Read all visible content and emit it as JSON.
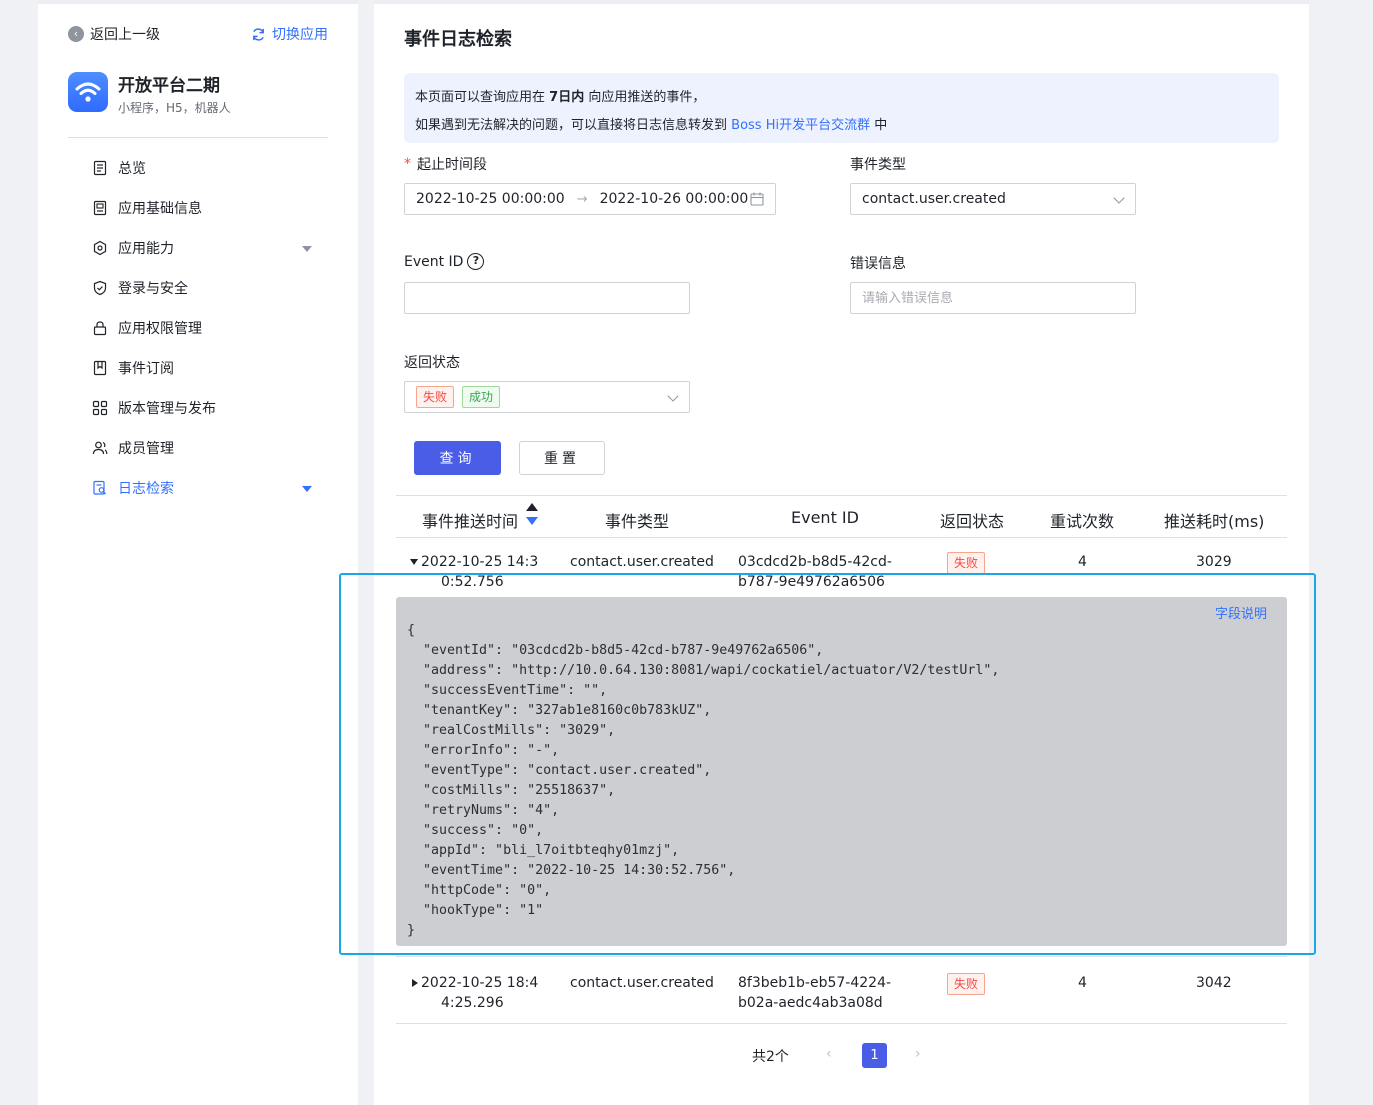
{
  "sidebar": {
    "back_label": "返回上一级",
    "switch_label": "切换应用",
    "app_name": "开放平台二期",
    "app_desc": "小程序，H5，机器人",
    "items": [
      {
        "label": "总览"
      },
      {
        "label": "应用基础信息"
      },
      {
        "label": "应用能力"
      },
      {
        "label": "登录与安全"
      },
      {
        "label": "应用权限管理"
      },
      {
        "label": "事件订阅"
      },
      {
        "label": "版本管理与发布"
      },
      {
        "label": "成员管理"
      },
      {
        "label": "日志检索"
      }
    ]
  },
  "main": {
    "title": "事件日志检索",
    "notice": {
      "line1_a": "本页面可以查询应用在",
      "line1_em": "7日内",
      "line1_b": "向应用推送的事件，",
      "line2_a": "如果遇到无法解决的问题，可以直接将日志信息转发到",
      "line2_link": "Boss Hi开发平台交流群",
      "line2_b": "中"
    },
    "form": {
      "time_label": "起止时间段",
      "time_start": "2022-10-25 00:00:00",
      "time_end": "2022-10-26 00:00:00",
      "event_type_label": "事件类型",
      "event_type_value": "contact.user.created",
      "event_id_label": "Event ID",
      "event_id_value": "",
      "error_label": "错误信息",
      "error_placeholder": "请输入错误信息",
      "status_label": "返回状态",
      "status_tags": [
        "失败",
        "成功"
      ],
      "query_btn": "查询",
      "reset_btn": "重置"
    },
    "table": {
      "columns": [
        "事件推送时间",
        "事件类型",
        "Event ID",
        "返回状态",
        "重试次数",
        "推送耗时(ms)"
      ],
      "rows": [
        {
          "time_l1": "2022-10-25 14:3",
          "time_l2": "0:52.756",
          "type": "contact.user.created",
          "id_l1": "03cdcd2b-b8d5-42cd-",
          "id_l2": "b787-9e49762a6506",
          "status": "失败",
          "retries": "4",
          "cost": "3029",
          "expanded": true
        },
        {
          "time_l1": "2022-10-25 18:4",
          "time_l2": "4:25.296",
          "type": "contact.user.created",
          "id_l1": "8f3beb1b-eb57-4224-",
          "id_l2": "b02a-aedc4ab3a08d",
          "status": "失败",
          "retries": "4",
          "cost": "3042",
          "expanded": false
        }
      ],
      "detail_link": "字段说明",
      "detail_json": "{\n  \"eventId\": \"03cdcd2b-b8d5-42cd-b787-9e49762a6506\",\n  \"address\": \"http://10.0.64.130:8081/wapi/cockatiel/actuator/V2/testUrl\",\n  \"successEventTime\": \"\",\n  \"tenantKey\": \"327ab1e8160c0b783kUZ\",\n  \"realCostMills\": \"3029\",\n  \"errorInfo\": \"-\",\n  \"eventType\": \"contact.user.created\",\n  \"costMills\": \"25518637\",\n  \"retryNums\": \"4\",\n  \"success\": \"0\",\n  \"appId\": \"bli_l7oitbteqhy01mzj\",\n  \"eventTime\": \"2022-10-25 14:30:52.756\",\n  \"httpCode\": \"0\",\n  \"hookType\": \"1\"\n}"
    },
    "pagination": {
      "total": "共2个",
      "current": "1"
    }
  },
  "colors": {
    "accent": "#3370ff",
    "primary_button": "#4a5de6",
    "fail": "#f54a45",
    "success": "#34a853",
    "highlight": "#1ba6ea"
  }
}
